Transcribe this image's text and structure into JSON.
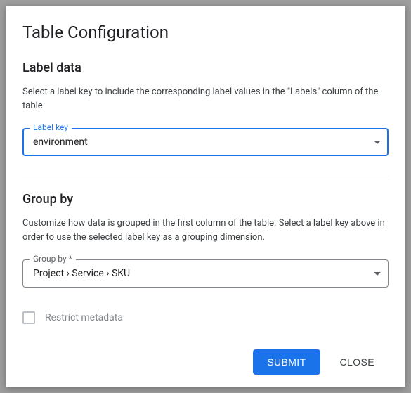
{
  "dialog": {
    "title": "Table Configuration"
  },
  "label_data": {
    "heading": "Label data",
    "description": "Select a label key to include the corresponding label values in the \"Labels\" column of the table.",
    "field_label": "Label key",
    "value": "environment"
  },
  "group_by": {
    "heading": "Group by",
    "description": "Customize how data is grouped in the first column of the table. Select a label key above in order to use the selected label key as a grouping dimension.",
    "field_label": "Group by *",
    "value": "Project › Service › SKU"
  },
  "restrict_metadata": {
    "label": "Restrict metadata",
    "checked": false
  },
  "actions": {
    "submit": "SUBMIT",
    "close": "CLOSE"
  }
}
